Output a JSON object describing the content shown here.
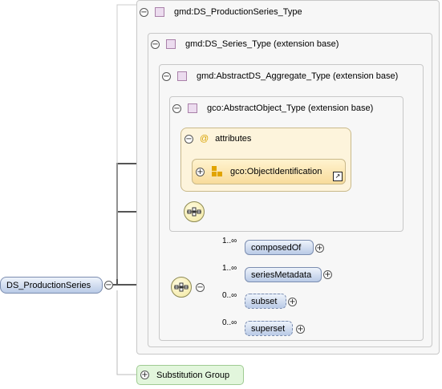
{
  "root": {
    "label": "DS_ProductionSeries"
  },
  "types": {
    "production_series": "gmd:DS_ProductionSeries_Type",
    "series_type": "gmd:DS_Series_Type (extension base)",
    "aggregate_type": "gmd:AbstractDS_Aggregate_Type (extension base)",
    "object_type": "gco:AbstractObject_Type (extension base)"
  },
  "attributes": {
    "label": "attributes",
    "group": "gco:ObjectIdentification"
  },
  "children": [
    {
      "label": "composedOf",
      "cardinality": "1..∞"
    },
    {
      "label": "seriesMetadata",
      "cardinality": "1..∞"
    },
    {
      "label": "subset",
      "cardinality": "0..∞"
    },
    {
      "label": "superset",
      "cardinality": "0..∞"
    }
  ],
  "substitution": {
    "label": "Substitution Group"
  },
  "colors": {
    "type_box": "#f7f7f7",
    "attributes_bg": "#fdf4dc",
    "element": "#c9d7ee",
    "substitution": "#e2f6dc"
  }
}
